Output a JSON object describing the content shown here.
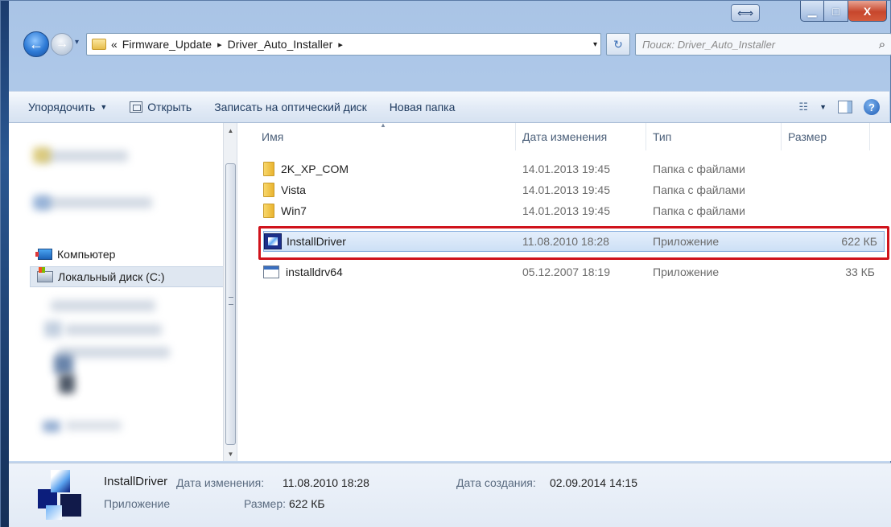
{
  "window": {
    "caption_resize": "⟺",
    "caption_min": "▁",
    "caption_max": "□",
    "caption_close": "X"
  },
  "address": {
    "overflow": "«",
    "crumbs": [
      "Firmware_Update",
      "Driver_Auto_Installer"
    ],
    "separator": "▸",
    "dropdown": "▾",
    "refresh": "↻",
    "search_placeholder": "Поиск: Driver_Auto_Installer"
  },
  "toolbar": {
    "organize": "Упорядочить",
    "open": "Открыть",
    "burn": "Записать на оптический диск",
    "new_folder": "Новая папка",
    "view": "☷",
    "help": "?"
  },
  "nav": {
    "computer": "Компьютер",
    "local_disk": "Локальный диск (C:)"
  },
  "columns": {
    "name": "Имя",
    "date": "Дата изменения",
    "type": "Тип",
    "size": "Размер"
  },
  "files": [
    {
      "name": "2K_XP_COM",
      "date": "14.01.2013 19:45",
      "type": "Папка с файлами",
      "size": "",
      "icon": "folder-icon"
    },
    {
      "name": "Vista",
      "date": "14.01.2013 19:45",
      "type": "Папка с файлами",
      "size": "",
      "icon": "folder-icon"
    },
    {
      "name": "Win7",
      "date": "14.01.2013 19:45",
      "type": "Папка с файлами",
      "size": "",
      "icon": "folder-icon"
    },
    {
      "name": "InstallDriver",
      "date": "11.08.2010 18:28",
      "type": "Приложение",
      "size": "622 КБ",
      "icon": "app-icon",
      "selected": true
    },
    {
      "name": "installdrv64",
      "date": "05.12.2007 18:19",
      "type": "Приложение",
      "size": "33 КБ",
      "icon": "exe-icon"
    }
  ],
  "details": {
    "name": "InstallDriver",
    "type": "Приложение",
    "modified_label": "Дата изменения:",
    "modified_value": "11.08.2010 18:28",
    "size_label": "Размер:",
    "size_value": "622 КБ",
    "created_label": "Дата создания:",
    "created_value": "02.09.2014 14:15"
  },
  "colors": {
    "highlight_frame": "#d0131c",
    "selection": "#cde0f6",
    "toolbar": "#e3ebf6"
  }
}
